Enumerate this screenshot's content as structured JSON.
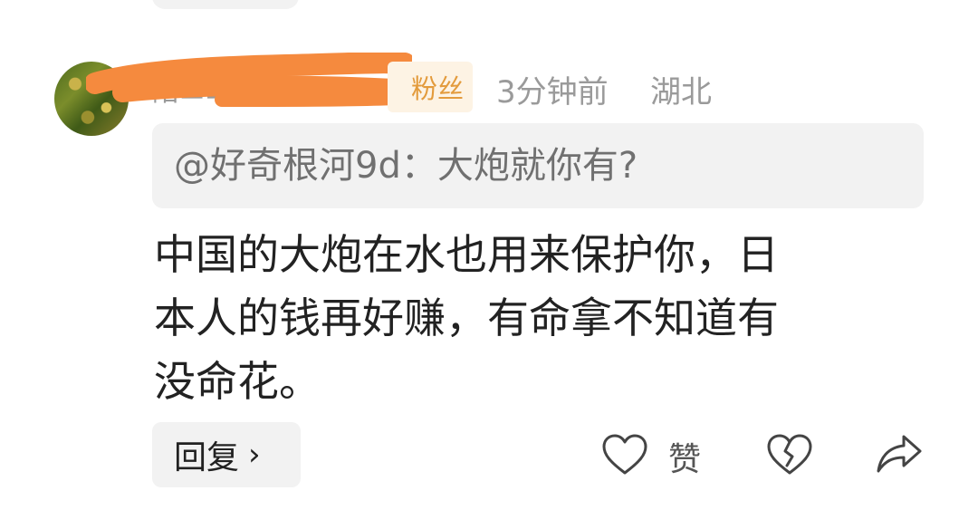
{
  "comment": {
    "user": {
      "name_partial": "陪▬▬▬瞭▬▬同",
      "badge": "粉丝",
      "time": "3分钟前",
      "region": "湖北"
    },
    "quote": "@好奇根河9d：大炮就你有?",
    "body_lines": [
      "中国的大炮在水也用来保护你，日",
      "本人的钱再好赚，有命拿不知道有",
      "没命花。"
    ],
    "actions": {
      "reply_label": "回复",
      "reply_chevron": "›",
      "like_label": "赞"
    }
  },
  "icons": {
    "like": "heart-outline-icon",
    "dislike": "broken-heart-icon",
    "share": "share-arrow-icon"
  },
  "colors": {
    "badge_text": "#e39b3c",
    "badge_bg": "#fdf3e4",
    "redaction": "#f58a3e",
    "meta_text": "#9a9a9a"
  }
}
